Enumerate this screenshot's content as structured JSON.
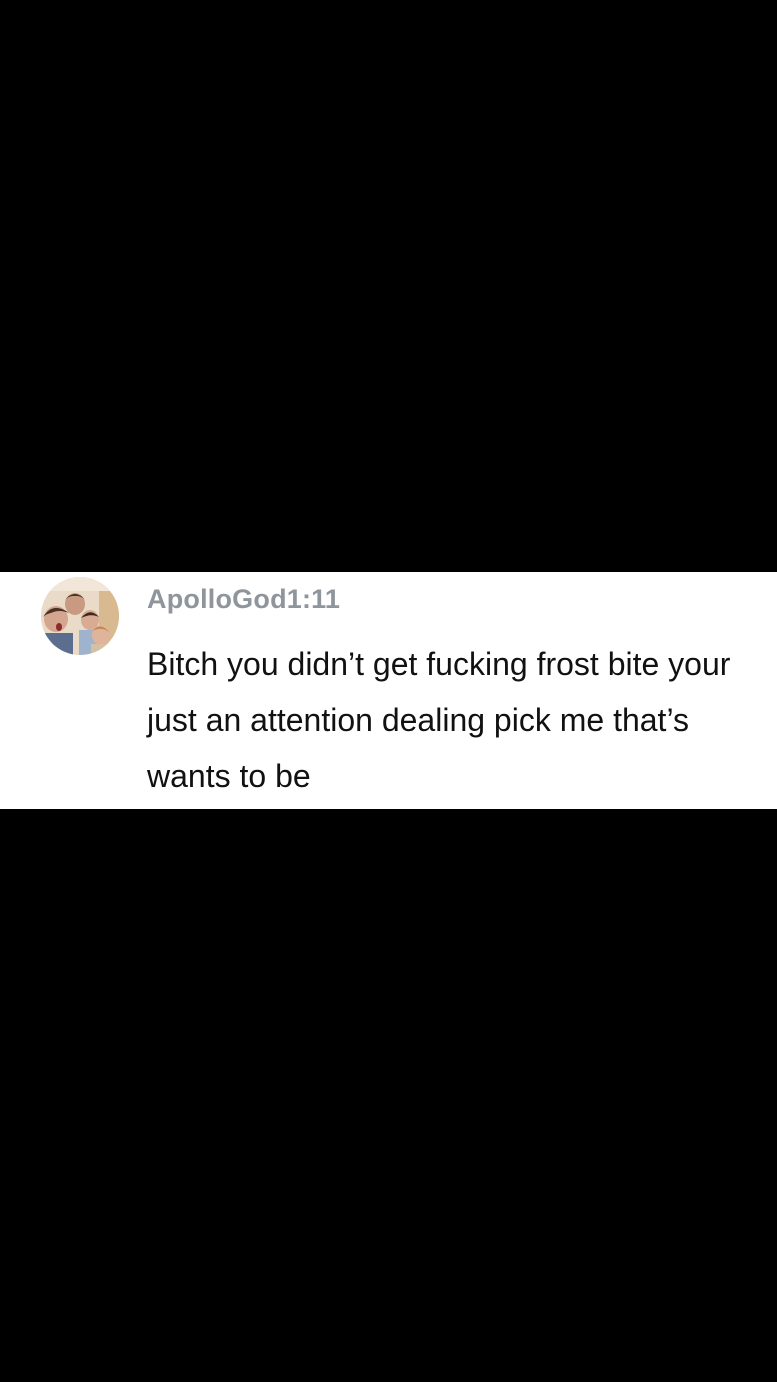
{
  "comment": {
    "username": "ApolloGod1:11",
    "text": "Bitch you didn’t get fucking frost bite your just an attention dealing pick me that’s wants to be",
    "avatar_icon": "user-avatar-photo"
  },
  "colors": {
    "background": "#000000",
    "card": "#ffffff",
    "username": "#8e959c",
    "text": "#111111"
  }
}
